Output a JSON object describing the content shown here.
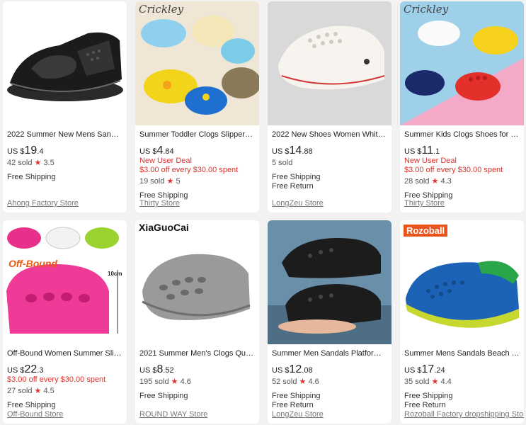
{
  "products": [
    {
      "title": "2022 Summer New Mens Sandals ...",
      "currency": "US $",
      "price_int": "19",
      "price_dec": ".4",
      "deal1": "",
      "deal2": "",
      "sold": "42 sold",
      "rating": "3.5",
      "ship1": "Free Shipping",
      "ship2": "",
      "store": "Ahong Factory Store",
      "brand_tag": "",
      "image": "black-mesh-sandal"
    },
    {
      "title": "Summer Toddler Clogs Slippers Ca...",
      "currency": "US $",
      "price_int": "4",
      "price_dec": ".84",
      "deal1": "New User Deal",
      "deal2": "$3.00 off every $30.00 spent",
      "sold": "19 sold",
      "rating": "5",
      "ship1": "Free Shipping",
      "ship2": "",
      "store": "Thirty Store",
      "brand_tag": "Crickley",
      "image": "kids-clogs-colorful"
    },
    {
      "title": "2022 New Shoes Women White Sh...",
      "currency": "US $",
      "price_int": "14",
      "price_dec": ".88",
      "deal1": "",
      "deal2": "",
      "sold": "5 sold",
      "rating": "",
      "ship1": "Free Shipping",
      "ship2": "Free Return",
      "store": "LongZeu Store",
      "brand_tag": "",
      "image": "white-clog"
    },
    {
      "title": "Summer Kids Clogs Shoes for Boys...",
      "currency": "US $",
      "price_int": "11",
      "price_dec": ".1",
      "deal1": "New User Deal",
      "deal2": "$3.00 off every $30.00 spent",
      "sold": "28 sold",
      "rating": "4.3",
      "ship1": "Free Shipping",
      "ship2": "",
      "store": "Thirty Store",
      "brand_tag": "Crickley",
      "image": "kids-clogs-multi"
    },
    {
      "title": "Off-Bound Women Summer Slippe...",
      "currency": "US $",
      "price_int": "22",
      "price_dec": ".3",
      "deal1": "",
      "deal2": "$3.00 off every $30.00 spent",
      "sold": "27 sold",
      "rating": "4.5",
      "ship1": "Free Shipping",
      "ship2": "",
      "store": "Off-Bound Store",
      "brand_tag": "",
      "image": "platform-clogs-pink"
    },
    {
      "title": "2021 Summer Men's Clogs Quick ...",
      "currency": "US $",
      "price_int": "8",
      "price_dec": ".52",
      "deal1": "",
      "deal2": "",
      "sold": "195 sold",
      "rating": "4.6",
      "ship1": "Free Shipping",
      "ship2": "",
      "store": "ROUND WAY Store",
      "brand_tag": "XiaGuoCai",
      "image": "grey-clog"
    },
    {
      "title": "Summer Men Sandals Platform Cl...",
      "currency": "US $",
      "price_int": "12",
      "price_dec": ".08",
      "deal1": "",
      "deal2": "",
      "sold": "52 sold",
      "rating": "4.6",
      "ship1": "Free Shipping",
      "ship2": "Free Return",
      "store": "LongZeu Store",
      "brand_tag": "",
      "image": "black-clogs-hands"
    },
    {
      "title": "Summer Mens Sandals Beach Spo...",
      "currency": "US $",
      "price_int": "17",
      "price_dec": ".24",
      "deal1": "",
      "deal2": "",
      "sold": "35 sold",
      "rating": "4.4",
      "ship1": "Free Shipping",
      "ship2": "Free Return",
      "store": "Rozoball Factory dropshipping Store",
      "brand_tag": "Rozoball",
      "image": "blue-green-clog"
    }
  ],
  "image_extra": {
    "off_bound_label": "Off-Bound",
    "height_label": "10cm"
  },
  "colors": {
    "accent_red": "#e0312d",
    "background": "#f2f2f2"
  }
}
